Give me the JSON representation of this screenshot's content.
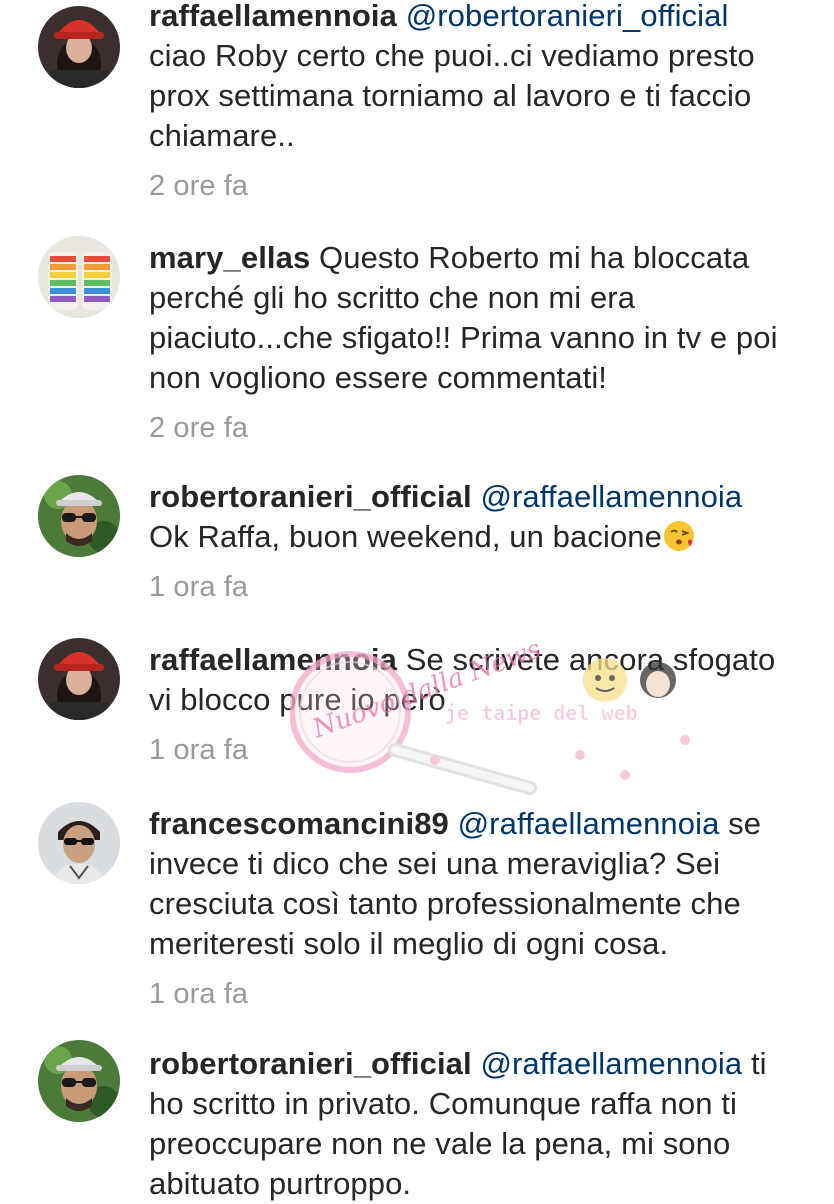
{
  "comments": [
    {
      "username": "raffaellamennoia",
      "mention": "@robertoranieri_official",
      "text": "ciao Roby certo che puoi..ci vediamo presto prox settimana torniamo al lavoro e ti faccio chiamare..",
      "time": "2 ore fa",
      "avatar": "avatar-red-hat"
    },
    {
      "username": "mary_ellas",
      "mention": "",
      "text": "Questo Roberto mi ha bloccata perché gli ho scritto che non mi era piaciuto...che sfigato!! Prima vanno in tv e poi non vogliono essere commentati!",
      "time": "2 ore fa",
      "avatar": "avatar-rainbow-cake"
    },
    {
      "username": "robertoranieri_official",
      "mention": "@raffaellamennoia",
      "text": "Ok Raffa, buon weekend, un bacione",
      "emoji": "kiss-emoji",
      "time": "1 ora fa",
      "avatar": "avatar-sunglasses-cap"
    },
    {
      "username": "raffaellamennoia",
      "mention": "",
      "text": "Se scrivete ancora sfogato vi blocco pure io però",
      "time": "1 ora fa",
      "avatar": "avatar-red-hat"
    },
    {
      "username": "francescomancini89",
      "mention": "@raffaellamennoia",
      "text": "se invece ti dico che sei una meraviglia? Sei cresciuta così tanto professionalmente che meriteresti solo il meglio di ogni cosa.",
      "time": "1 ora fa",
      "avatar": "avatar-sunglasses-man"
    },
    {
      "username": "robertoranieri_official",
      "mention": "@raffaellamennoia",
      "text": "ti ho scritto in privato. Comunque raffa non ti preoccupare non ne vale la pena, mi sono abituato purtroppo.",
      "time": "",
      "avatar": "avatar-sunglasses-cap"
    }
  ],
  "watermark": {
    "script_text": "Nuovo dalla News",
    "banner_text": "je taipe del web"
  },
  "colors": {
    "text": "#262626",
    "mention": "#003569",
    "timestamp": "#999999",
    "watermark_pink": "#e86fa8"
  }
}
